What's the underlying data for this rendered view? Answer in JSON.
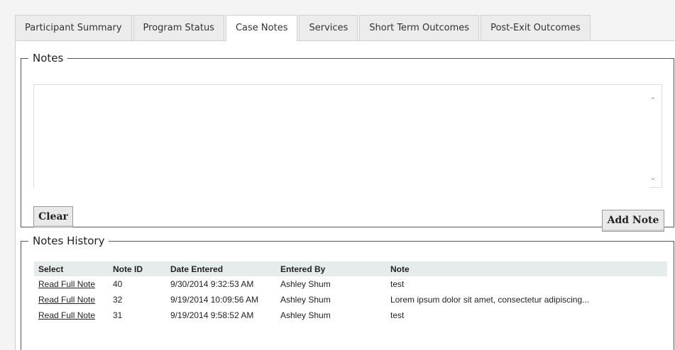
{
  "tabs": [
    {
      "label": "Participant Summary",
      "active": false
    },
    {
      "label": "Program Status",
      "active": false
    },
    {
      "label": "Case Notes",
      "active": true
    },
    {
      "label": "Services",
      "active": false
    },
    {
      "label": "Short Term Outcomes",
      "active": false
    },
    {
      "label": "Post-Exit Outcomes",
      "active": false
    }
  ],
  "notes": {
    "legend": "Notes",
    "text": "",
    "clear_label": "Clear",
    "add_label": "Add Note"
  },
  "history": {
    "legend": "Notes History",
    "columns": [
      "Select",
      "Note ID",
      "Date Entered",
      "Entered By",
      "Note"
    ],
    "rows": [
      {
        "select": "Read Full Note",
        "note_id": "40",
        "date": "9/30/2014 9:32:53 AM",
        "entered_by": "Ashley Shum",
        "note": "test"
      },
      {
        "select": "Read Full Note",
        "note_id": "32",
        "date": "9/19/2014 10:09:56 AM",
        "entered_by": "Ashley Shum",
        "note": "Lorem ipsum dolor sit amet, consectetur adipiscing..."
      },
      {
        "select": "Read Full Note",
        "note_id": "31",
        "date": "9/19/2014 9:58:52 AM",
        "entered_by": "Ashley Shum",
        "note": "test"
      }
    ]
  }
}
